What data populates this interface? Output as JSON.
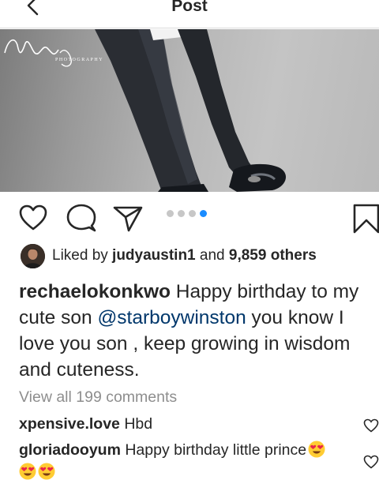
{
  "header": {
    "title": "Post"
  },
  "post": {
    "photo_watermark": "Nonnie Photography",
    "carousel": {
      "count": 4,
      "active_index": 3
    },
    "likes": {
      "prefix": "Liked by ",
      "user": "judyaustin1",
      "middle": " and ",
      "others": "9,859 others"
    },
    "caption": {
      "username": "rechaelokonkwo",
      "text_1": " Happy birthday to my cute son ",
      "mention": "@starboywinston",
      "text_2": " you know I love you son , keep growing in wisdom and cuteness."
    },
    "view_all_comments": "View all 199 comments",
    "comments": [
      {
        "username": "xpensive.love",
        "text": " Hbd"
      },
      {
        "username": "gloriadooyum",
        "text": " Happy birthday little prince"
      }
    ]
  },
  "colors": {
    "mention": "#00376b",
    "active_dot": "#1a8cff",
    "muted_text": "#8e8e8e"
  }
}
